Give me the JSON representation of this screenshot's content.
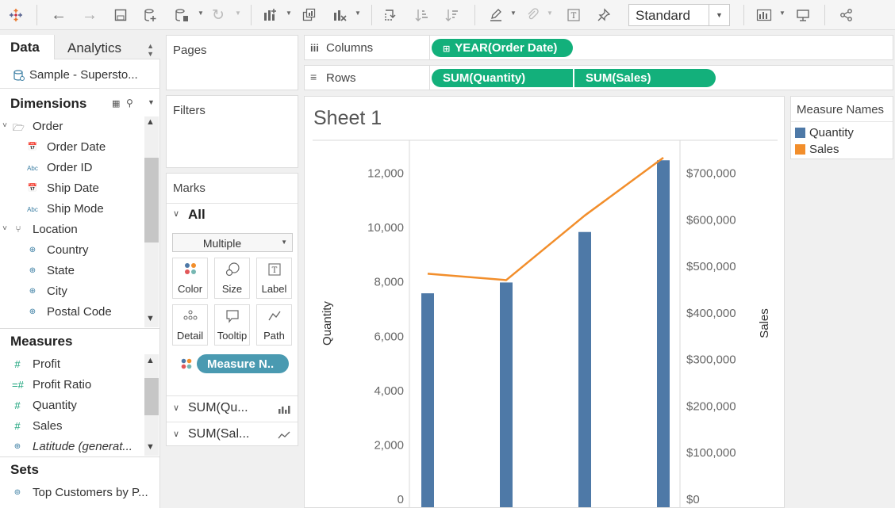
{
  "toolbar": {
    "icons": [
      "tableau-logo-icon",
      "undo-icon",
      "redo-icon",
      "save-icon",
      "new-datasource-icon",
      "pause-updates-icon",
      "refresh-icon",
      "new-worksheet-icon",
      "duplicate-sheet-icon",
      "clear-sheet-icon",
      "swap-icon",
      "sort-ascending-icon",
      "sort-descending-icon",
      "highlight-icon",
      "group-icon",
      "label-icon",
      "pin-icon",
      "show-me-icon",
      "presentation-icon",
      "share-icon"
    ],
    "view_size": "Standard"
  },
  "data_pane": {
    "tab_data": "Data",
    "tab_analytics": "Analytics",
    "datasource": "Sample - Supersto...",
    "dimensions_header": "Dimensions",
    "dimensions": [
      {
        "label": "Order",
        "icon": "folder-icon",
        "kind": "folder"
      },
      {
        "label": "Order Date",
        "icon": "date-icon",
        "kind": "field"
      },
      {
        "label": "Order ID",
        "icon": "abc-icon",
        "kind": "field"
      },
      {
        "label": "Ship Date",
        "icon": "date-icon",
        "kind": "field"
      },
      {
        "label": "Ship Mode",
        "icon": "abc-icon",
        "kind": "field"
      },
      {
        "label": "Location",
        "icon": "hierarchy-icon",
        "kind": "folder"
      },
      {
        "label": "Country",
        "icon": "globe-icon",
        "kind": "field"
      },
      {
        "label": "State",
        "icon": "globe-icon",
        "kind": "field"
      },
      {
        "label": "City",
        "icon": "globe-icon",
        "kind": "field"
      },
      {
        "label": "Postal Code",
        "icon": "globe-icon",
        "kind": "field"
      }
    ],
    "measures_header": "Measures",
    "measures": [
      {
        "label": "Profit",
        "icon": "number-icon"
      },
      {
        "label": "Profit Ratio",
        "icon": "calc-number-icon"
      },
      {
        "label": "Quantity",
        "icon": "number-icon"
      },
      {
        "label": "Sales",
        "icon": "number-icon"
      },
      {
        "label": "Latitude (generat...",
        "icon": "globe-icon"
      }
    ],
    "sets_header": "Sets",
    "sets": [
      {
        "label": "Top Customers by P...",
        "icon": "set-icon"
      }
    ]
  },
  "shelves": {
    "pages": "Pages",
    "filters": "Filters",
    "columns_label": "Columns",
    "rows_label": "Rows",
    "columns_pills": [
      "YEAR(Order Date)"
    ],
    "rows_pills": [
      "SUM(Quantity)",
      "SUM(Sales)"
    ]
  },
  "marks": {
    "title": "Marks",
    "all_label": "All",
    "mark_type": "Multiple",
    "buttons": [
      {
        "label": "Color",
        "icon": "color-icon"
      },
      {
        "label": "Size",
        "icon": "size-icon"
      },
      {
        "label": "Label",
        "icon": "label-icon"
      },
      {
        "label": "Detail",
        "icon": "detail-icon"
      },
      {
        "label": "Tooltip",
        "icon": "tooltip-icon"
      },
      {
        "label": "Path",
        "icon": "path-icon"
      }
    ],
    "color_pill": "Measure N..",
    "cards": [
      {
        "label": "SUM(Qu...",
        "icon": "bar-chart-icon"
      },
      {
        "label": "SUM(Sal...",
        "icon": "line-chart-icon"
      }
    ]
  },
  "sheet": {
    "title": "Sheet 1"
  },
  "legend": {
    "title": "Measure Names",
    "items": [
      {
        "label": "Quantity",
        "color": "#4e79a7"
      },
      {
        "label": "Sales",
        "color": "#f28e2b"
      }
    ]
  },
  "chart_data": {
    "type": "bar",
    "categories": [
      "",
      "",
      "",
      ""
    ],
    "series": [
      {
        "name": "Quantity",
        "type": "bar",
        "axis": "left",
        "color": "#4e79a7",
        "values": [
          7581,
          7979,
          9837,
          12476
        ]
      },
      {
        "name": "Sales",
        "type": "line",
        "axis": "right",
        "color": "#f28e2b",
        "values": [
          484247,
          470533,
          609206,
          733215
        ]
      }
    ],
    "ylabel": "Quantity",
    "ylabel_right": "Sales",
    "ylim": [
      0,
      12600
    ],
    "ylim_right": [
      0,
      735000
    ],
    "yticks": [
      0,
      2000,
      4000,
      6000,
      8000,
      10000,
      12000
    ],
    "yticklabels": [
      "0",
      "2,000",
      "4,000",
      "6,000",
      "8,000",
      "10,000",
      "12,000"
    ],
    "yticks_right": [
      0,
      100000,
      200000,
      300000,
      400000,
      500000,
      600000,
      700000
    ],
    "yticklabels_right": [
      "$0",
      "$100,000",
      "$200,000",
      "$300,000",
      "$400,000",
      "$500,000",
      "$600,000",
      "$700,000"
    ],
    "grid": false
  }
}
